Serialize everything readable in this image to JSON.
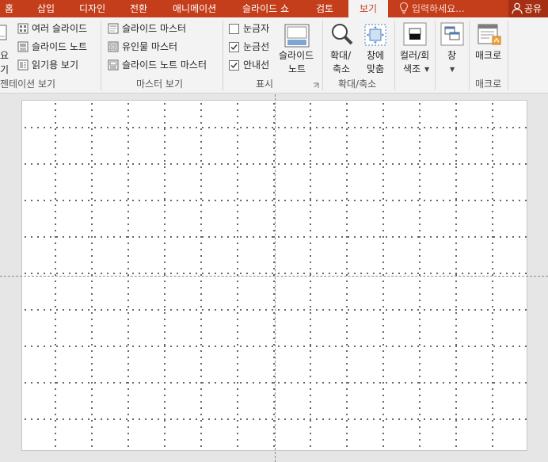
{
  "tabs": {
    "home": "홈",
    "insert": "삽입",
    "design": "디자인",
    "transitions": "전환",
    "animations": "애니메이션",
    "slideshow": "슬라이드 쇼",
    "review": "검토",
    "view": "보기"
  },
  "tell_me": {
    "placeholder": "입력하세요..."
  },
  "share": {
    "label": "공유"
  },
  "ribbon": {
    "presentation_views": {
      "cut_label_line1": "요",
      "cut_label_line2": "기",
      "slide_sorter": "여러 슬라이드",
      "notes_page": "슬라이드 노트",
      "reading_view": "읽기용 보기",
      "group_label": "젠테이션 보기"
    },
    "master_views": {
      "slide_master": "슬라이드 마스터",
      "handout_master": "유인물 마스터",
      "notes_master": "슬라이드 노트 마스터",
      "group_label": "마스터 보기"
    },
    "show": {
      "ruler": {
        "label": "눈금자",
        "checked": false
      },
      "gridlines": {
        "label": "눈금선",
        "checked": true
      },
      "guides": {
        "label": "안내선",
        "checked": true
      },
      "notes_line1": "슬라이드",
      "notes_line2": "노트",
      "group_label": "표시"
    },
    "zoom": {
      "zoom_line1": "확대/",
      "zoom_line2": "축소",
      "fit_line1": "창에",
      "fit_line2": "맞춤",
      "group_label": "확대/축소"
    },
    "color": {
      "line1": "컬러/회",
      "line2": "색조"
    },
    "window": {
      "label": "창"
    },
    "macros": {
      "label": "매크로",
      "group_label": "매크로"
    }
  },
  "colors": {
    "accent": "#c43e1c",
    "ribbon_bg": "#f3f3f3",
    "canvas_bg": "#e6e6e6",
    "slide_bg": "#ffffff"
  }
}
